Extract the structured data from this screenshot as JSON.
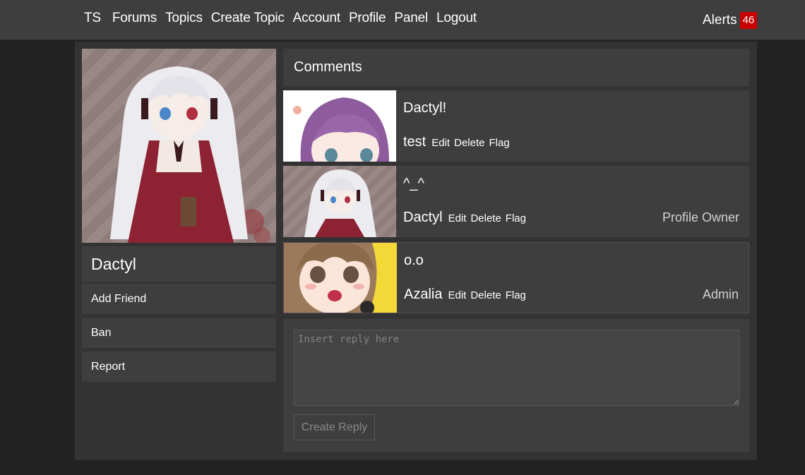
{
  "nav": {
    "brand": "TS",
    "links": [
      "Forums",
      "Topics",
      "Create Topic",
      "Account",
      "Profile",
      "Panel",
      "Logout"
    ],
    "alerts_label": "Alerts",
    "alerts_count": "46"
  },
  "profile": {
    "name": "Dactyl",
    "actions": [
      "Add Friend",
      "Ban",
      "Report"
    ]
  },
  "comments": {
    "title": "Comments",
    "items": [
      {
        "text": "Dactyl!",
        "author": "test",
        "actions": [
          "Edit",
          "Delete",
          "Flag"
        ],
        "tag": ""
      },
      {
        "text": "^_^",
        "author": "Dactyl",
        "actions": [
          "Edit",
          "Delete",
          "Flag"
        ],
        "tag": "Profile Owner"
      },
      {
        "text": "o.o",
        "author": "Azalia",
        "actions": [
          "Edit",
          "Delete",
          "Flag"
        ],
        "tag": "Admin"
      }
    ]
  },
  "reply": {
    "placeholder": "Insert reply here",
    "button_label": "Create Reply"
  },
  "colors": {
    "page_bg": "#222222",
    "nav_bg": "#3e3e3e",
    "panel_bg": "#3e3e3e",
    "container_bg": "#333333",
    "alert_badge": "#c80000"
  }
}
